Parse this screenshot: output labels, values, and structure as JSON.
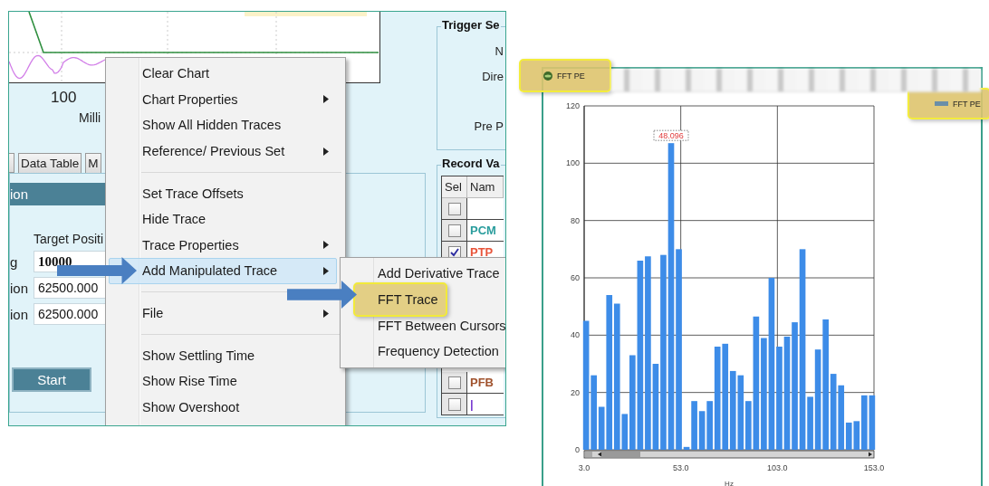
{
  "left_screenshot": {
    "trace_chart": {
      "tick_label": "100",
      "axis_label": "Milli"
    },
    "trigger_settings": {
      "title": "Trigger Se",
      "labels": [
        "N",
        "Dire",
        "Pre P"
      ]
    },
    "tabs": [
      {
        "label": "Data Table",
        "selected": false
      },
      {
        "label": "M",
        "selected": false
      }
    ],
    "section_header": "ion",
    "target_position": {
      "heading": "Target Positi",
      "rows": [
        {
          "label": "g",
          "value": "10000",
          "bold": true
        },
        {
          "label": "ion",
          "value": "62500.000",
          "bold": false
        },
        {
          "label": "ion",
          "value": "62500.000",
          "bold": false
        }
      ]
    },
    "start_button": "Start",
    "record_values": {
      "title": "Record Va",
      "columns": [
        "Sel",
        "Nam"
      ],
      "rows": [
        {
          "checked": false
        },
        {
          "name": "PCM",
          "checked": false,
          "color": "#2a9d9d"
        },
        {
          "name": "PTP",
          "checked": true,
          "color": "#e8543a"
        },
        {
          "name": "PFB",
          "checked": false,
          "color": "#a0522d"
        },
        {
          "name": "|",
          "checked": false,
          "color": "#7b3fd1"
        }
      ]
    },
    "context_menu": {
      "items": [
        {
          "kind": "item",
          "label": "Clear Chart",
          "submenu": false,
          "highlighted": false
        },
        {
          "kind": "item",
          "label": "Chart Properties",
          "submenu": true,
          "highlighted": false
        },
        {
          "kind": "item",
          "label": "Show All Hidden Traces",
          "submenu": false,
          "highlighted": false
        },
        {
          "kind": "item",
          "label": "Reference/ Previous Set",
          "submenu": true,
          "highlighted": false
        },
        {
          "kind": "separator"
        },
        {
          "kind": "item",
          "label": "Set Trace Offsets",
          "submenu": false,
          "highlighted": false
        },
        {
          "kind": "item",
          "label": "Hide Trace",
          "submenu": false,
          "highlighted": false
        },
        {
          "kind": "item",
          "label": "Trace Properties",
          "submenu": true,
          "highlighted": false
        },
        {
          "kind": "item",
          "label": "Add Manipulated Trace",
          "submenu": true,
          "highlighted": true
        },
        {
          "kind": "separator"
        },
        {
          "kind": "item",
          "label": "File",
          "submenu": true,
          "highlighted": false
        },
        {
          "kind": "separator"
        },
        {
          "kind": "item",
          "label": "Show Settling Time",
          "submenu": false,
          "highlighted": false
        },
        {
          "kind": "item",
          "label": "Show Rise Time",
          "submenu": false,
          "highlighted": false
        },
        {
          "kind": "item",
          "label": "Show Overshoot",
          "submenu": false,
          "highlighted": false
        }
      ]
    },
    "submenu": {
      "items": [
        {
          "label": "Add Derivative Trace",
          "highlighted": false
        },
        {
          "label": "FFT Trace",
          "highlighted": true
        },
        {
          "label": "FFT Between Cursors",
          "highlighted": false
        },
        {
          "label": "Frequency Detection",
          "highlighted": false
        }
      ]
    }
  },
  "fft_window": {
    "title": "FFT PE",
    "chart_data": {
      "type": "bar",
      "xlabel": "Hz",
      "grid": true,
      "x": [
        4,
        8,
        12,
        16,
        20,
        24,
        28,
        32,
        36,
        40,
        44,
        48,
        52,
        56,
        60,
        64,
        68,
        72,
        76,
        80,
        84,
        88,
        92,
        96,
        100,
        104,
        108,
        112,
        116,
        120,
        124,
        128,
        132,
        136,
        140,
        144,
        148,
        152
      ],
      "series": [
        {
          "name": "FFT PE",
          "color": "#3d8ce8",
          "values": [
            45,
            26,
            15,
            54,
            51,
            12.5,
            33,
            66,
            67.5,
            30,
            68,
            107,
            70,
            1,
            17,
            13.5,
            17,
            36,
            37,
            27.5,
            26,
            17,
            46.5,
            39,
            60,
            36,
            39.5,
            44.5,
            70,
            18.5,
            35,
            45.5,
            26.5,
            22.5,
            9.5,
            10,
            19,
            19
          ]
        }
      ],
      "xlim": [
        3,
        153
      ],
      "ylim": [
        0,
        120
      ],
      "xticks": [
        {
          "value": 3,
          "label": "3.0"
        },
        {
          "value": 53,
          "label": "53.0"
        },
        {
          "value": 103,
          "label": "103.0"
        },
        {
          "value": 153,
          "label": "153.0"
        }
      ],
      "yticks": [
        0,
        20,
        40,
        60,
        80,
        100,
        120
      ],
      "annotations": [
        {
          "x": 48,
          "y": 107,
          "text": "48.096"
        }
      ]
    }
  }
}
